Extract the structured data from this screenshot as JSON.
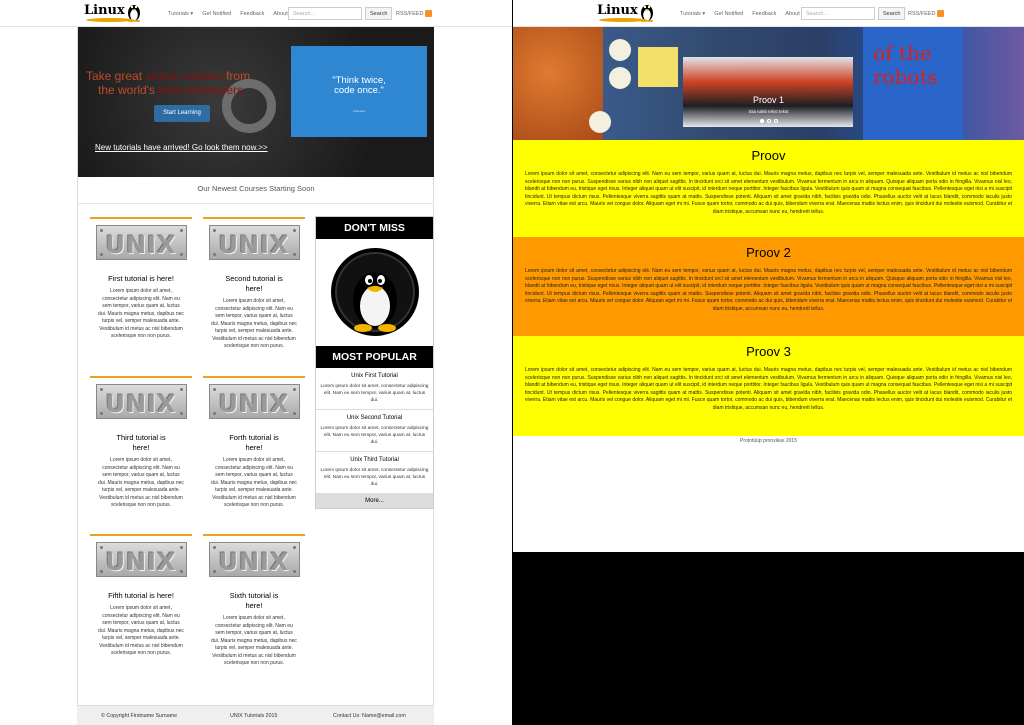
{
  "left": {
    "logo_text": "Linux",
    "nav": {
      "tutorials": "Tutorials ▾",
      "get_notified": "Get Notified",
      "feedback": "Feedback",
      "about": "About"
    },
    "search": {
      "placeholder": "Search...",
      "button": "Search"
    },
    "rss": "RSS/FEED",
    "hero": {
      "line1_a": "Take great ",
      "line1_hl": "online courses",
      "line1_b": " from",
      "line2_a": "the world's ",
      "line2_hl": "best developers",
      "start_button": "Start Learning",
      "quote": "\"Think twice,\ncode once.\"",
      "quote_small": "Unknown",
      "link": "New tutorials have arrived! Go look them now.>>"
    },
    "section_title": "Our Newest Courses Starting Soon",
    "plate_text": "UNIX",
    "courses": [
      {
        "title": "First tutorial is here!",
        "text": "Lorem ipsum dolor sit amet, consectetur adipiscing elit. Nam eu sem tempor, varius quam at, luctus dui. Mauris magna metus, dapibus nec turpis vel, semper malesuada ante. Vestibulum id metus ac nisl bibendum scelerisque non non purus."
      },
      {
        "title": "Second tutorial is here!",
        "text": "Lorem ipsum dolor sit amet, consectetur adipiscing elit. Nam eu sem tempor, varius quam at, luctus dui. Mauris magna metus, dapibus nec turpis vel, semper malesuada ante. Vestibulum id metus ac nisl bibendum scelerisque non non purus."
      },
      {
        "title": "Third tutorial is here!",
        "text": "Lorem ipsum dolor sit amet, consectetur adipiscing elit. Nam eu sem tempor, varius quam at, luctus dui. Mauris magna metus, dapibus nec turpis vel, semper malesuada ante. Vestibulum id metus ac nisl bibendum scelerisque non non purus."
      },
      {
        "title": "Forth tutorial is here!",
        "text": "Lorem ipsum dolor sit amet, consectetur adipiscing elit. Nam eu sem tempor, varius quam at, luctus dui. Mauris magna metus, dapibus nec turpis vel, semper malesuada ante. Vestibulum id metus ac nisl bibendum scelerisque non non purus."
      },
      {
        "title": "Fifth tutorial is here!",
        "text": "Lorem ipsum dolor sit amet, consectetur adipiscing elit. Nam eu sem tempor, varius quam at, luctus dui. Mauris magna metus, dapibus nec turpis vel, semper malesuada ante. Vestibulum id metus ac nisl bibendum scelerisque non non purus."
      },
      {
        "title": "Sixth tutorial is here!",
        "text": "Lorem ipsum dolor sit amet, consectetur adipiscing elit. Nam eu sem tempor, varius quam at, luctus dui. Mauris magna metus, dapibus nec turpis vel, semper malesuada ante. Vestibulum id metus ac nisl bibendum scelerisque non non purus."
      }
    ],
    "sidebar": {
      "dont_miss": "DON'T MISS",
      "most_popular": "MOST POPULAR",
      "popular": [
        {
          "title": "Unix First Tutorial",
          "text": "Lorem ipsum dolor sit amet, consectetur adipiscing elit. Nam eu sem tempor, varius quam at, luctus dui."
        },
        {
          "title": "Unix Second Tutorial",
          "text": "Lorem ipsum dolor sit amet, consectetur adipiscing elit. Nam eu sem tempor, varius quam at, luctus dui."
        },
        {
          "title": "Unix Third Tutorial",
          "text": "Lorem ipsum dolor sit amet, consectetur adipiscing elit. Nam eu sem tempor, varius quam at, luctus dui."
        }
      ],
      "more": "More..."
    },
    "footer": {
      "copyright": "© Copyright Firstname Surname",
      "center": "UNIX Tutorials 2015",
      "contact": "Contact Us: Name@email.com"
    }
  },
  "right": {
    "logo_text": "Linux",
    "nav": {
      "tutorials": "Tutorials ▾",
      "get_notified": "Get Notified",
      "feedback": "Feedback",
      "about": "About"
    },
    "search": {
      "placeholder": "Search...",
      "button": "Search"
    },
    "rss": "RSS/FEED",
    "carousel": {
      "caption": "Proov 1",
      "sub": "Siia tuleb tekst tekst",
      "slide_count": 3,
      "active_slide": 1
    },
    "sections": [
      {
        "title": "Proov",
        "color": "#ffff00",
        "text": "Lorem ipsum dolor sit amet, consectetur adipiscing elit. Nam eu sem tempor, varius quam at, luctus dui. Mauris magna metus, dapibus nec turpis vel, semper malesuada ante. Vestibulum id metus ac nisl bibendum scelerisque non non purus. Suspendisse varius nibh non aliquet sagittis. In tincidunt orci sit amet elementum vestibulum. Vivamus fermentum in arcu in aliquam. Quisque aliquam porta odio in fringilla. Vivamus nisl leo, blandit at bibendum eu, tristique eget risus. Integer aliquet quam ut elit suscipit, id interdum neque porttitor. Integer faucibus ligula. Vestibulum quis quam ut magna consequat faucibus. Pellentesque eget nisi a mi suscipit tincidunt. Ut tempus dictum risus. Pellentesque viverra sagittis quam at mattis. Suspendisse potenti. Aliquam sit amet gravida nibh, facilisis gravida odio. Phasellus auctor velit at lacus blandit, commodo iaculis justo viverra. Etiam vitae est arcu. Mauris vel congue dolor. Aliquam eget mi mi. Fusce quam tortor, commodo ac dui quis, bibendum viverra erat. Maecenas mattis lectus enim, quis tincidunt dui molestie euismod. Curabitur et diam tristique, accumsan nunc eu, hendrerit tellus."
      },
      {
        "title": "Proov 2",
        "color": "#ff9900",
        "text": "Lorem ipsum dolor sit amet, consectetur adipiscing elit. Nam eu sem tempor, varius quam at, luctus dui. Mauris magna metus, dapibus nec turpis vel, semper malesuada ante. Vestibulum id metus ac nisl bibendum scelerisque non non purus. Suspendisse varius nibh non aliquet sagittis. In tincidunt orci sit amet elementum vestibulum. Vivamus fermentum in arcu in aliquam. Quisque aliquam porta odio in fringilla. Vivamus nisl leo, blandit at bibendum eu, tristique eget risus. Integer aliquet quam ut elit suscipit, id interdum neque porttitor. Integer faucibus ligula. Vestibulum quis quam ut magna consequat faucibus. Pellentesque eget nisi a mi suscipit tincidunt. Ut tempus dictum risus. Pellentesque viverra sagittis quam at mattis. Suspendisse potenti. Aliquam sit amet gravida nibh, facilisis gravida odio. Phasellus auctor velit at lacus blandit, commodo iaculis justo viverra. Etiam vitae est arcu. Mauris vel congue dolor. Aliquam eget mi mi. Fusce quam tortor, commodo ac dui quis, bibendum viverra erat. Maecenas mattis lectus enim, quis tincidunt dui molestie euismod. Curabitur et diam tristique, accumsan nunc eu, hendrerit tellus."
      },
      {
        "title": "Proov 3",
        "color": "#ffff00",
        "text": "Lorem ipsum dolor sit amet, consectetur adipiscing elit. Nam eu sem tempor, varius quam at, luctus dui. Mauris magna metus, dapibus nec turpis vel, semper malesuada ante. Vestibulum id metus ac nisl bibendum scelerisque non non purus. Suspendisse varius nibh non aliquet sagittis. In tincidunt orci sit amet elementum vestibulum. Vivamus fermentum in arcu in aliquam. Quisque aliquam porta odio in fringilla. Vivamus nisl leo, blandit at bibendum eu, tristique eget risus. Integer aliquet quam ut elit suscipit, id interdum neque porttitor. Integer faucibus ligula. Vestibulum quis quam ut magna consequat faucibus. Pellentesque eget nisi a mi suscipit tincidunt. Ut tempus dictum risus. Pellentesque viverra sagittis quam at mattis. Suspendisse potenti. Aliquam sit amet gravida nibh, facilisis gravida odio. Phasellus auctor velit at lacus blandit, commodo iaculis justo viverra. Etiam vitae est arcu. Mauris vel congue dolor. Aliquam eget mi mi. Fusce quam tortor, commodo ac dui quis, bibendum viverra erat. Maecenas mattis lectus enim, quis tincidunt dui molestie euismod. Curabitur et diam tristique, accumsan nunc eu, hendrerit tellus."
      }
    ],
    "footer": "Prototüüp proovikas 2015"
  },
  "colors": {
    "accent_orange": "#f0a020",
    "start_button": "#2e6da4",
    "quote_box": "#2f86d1",
    "hero_text": "#c04a2a",
    "yellow": "#ffff00",
    "orange": "#ff9900"
  },
  "icons": [
    "tux-penguin-icon",
    "rss-icon",
    "chevron-down-icon"
  ]
}
